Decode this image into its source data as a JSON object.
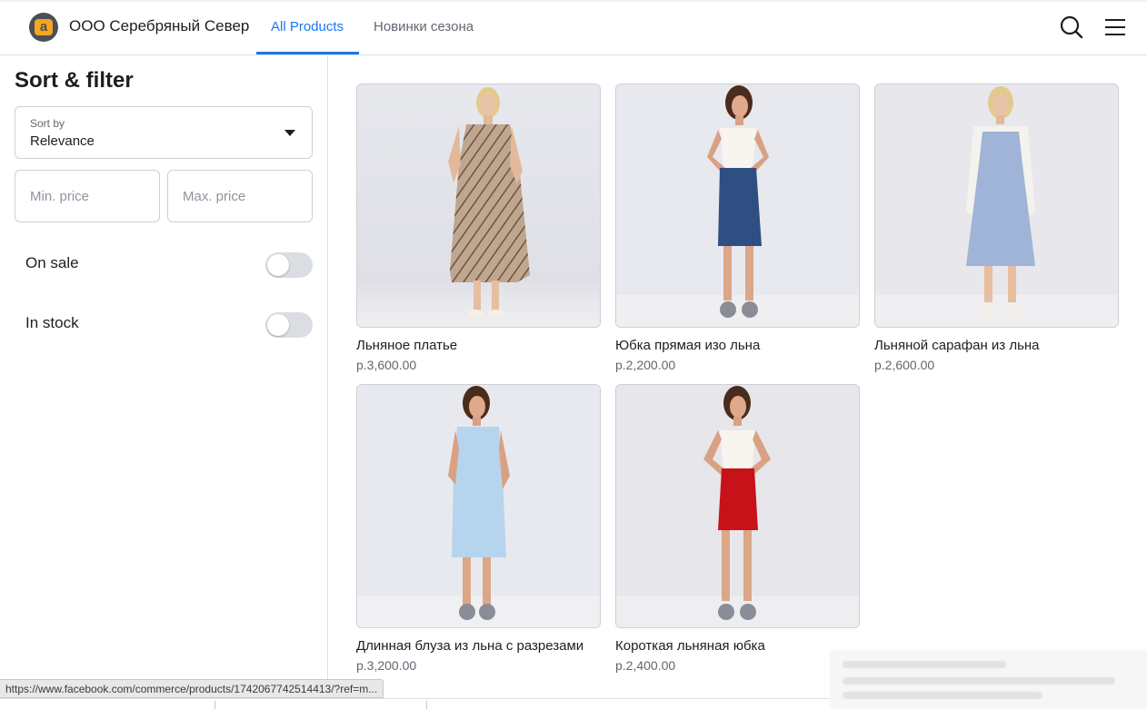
{
  "header": {
    "shop_name": "ООО Серебряный Север",
    "logo_letter": "a",
    "tabs": [
      {
        "label": "All Products",
        "active": true
      },
      {
        "label": "Новинки сезона",
        "active": false
      }
    ],
    "icons": [
      "search-icon",
      "menu-icon"
    ],
    "accent_color": "#1877f2"
  },
  "sidebar": {
    "title": "Sort & filter",
    "sort": {
      "label": "Sort by",
      "value": "Relevance"
    },
    "min_price": {
      "placeholder": "Min. price",
      "value": ""
    },
    "max_price": {
      "placeholder": "Max. price",
      "value": ""
    },
    "toggles": [
      {
        "label": "On sale",
        "on": false
      },
      {
        "label": "In stock",
        "on": false
      }
    ]
  },
  "products": [
    {
      "title": "Льняное платье",
      "price": "р.3,600.00"
    },
    {
      "title": "Юбка прямая изо льна",
      "price": "р.2,200.00"
    },
    {
      "title": "Льняной сарафан из льна",
      "price": "р.2,600.00"
    },
    {
      "title": "Длинная блуза из льна с разрезами",
      "price": "р.3,200.00"
    },
    {
      "title": "Короткая льняная юбка",
      "price": "р.2,400.00"
    }
  ],
  "status_bar": {
    "url": "https://www.facebook.com/commerce/products/1742067742514413/?ref=m..."
  }
}
